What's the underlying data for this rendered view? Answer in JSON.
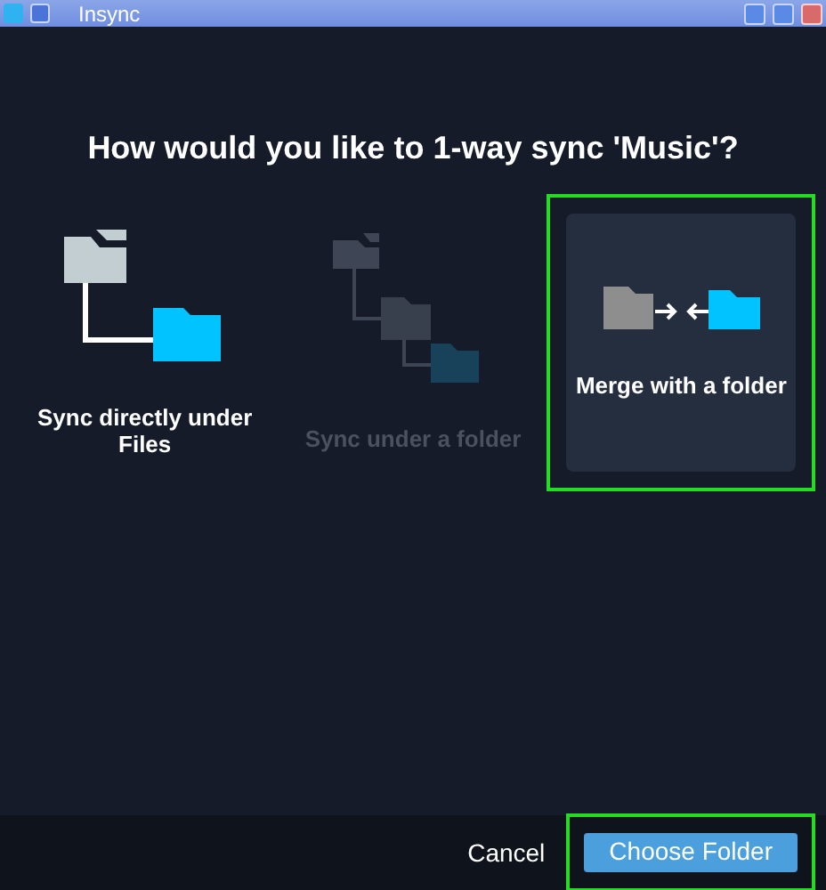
{
  "window": {
    "title": "Insync"
  },
  "heading": "How would you like to 1-way sync 'Music'?",
  "options": [
    {
      "kind": "direct",
      "label": "Sync directly under Files",
      "selected": false,
      "disabled": false,
      "highlighted": false
    },
    {
      "kind": "nested",
      "label": "Sync under a folder",
      "selected": false,
      "disabled": true,
      "highlighted": false
    },
    {
      "kind": "merge",
      "label": "Merge with a folder",
      "selected": true,
      "disabled": false,
      "highlighted": true
    }
  ],
  "footer": {
    "cancel": "Cancel",
    "confirm": {
      "label": "Choose Folder",
      "highlighted": true
    }
  }
}
